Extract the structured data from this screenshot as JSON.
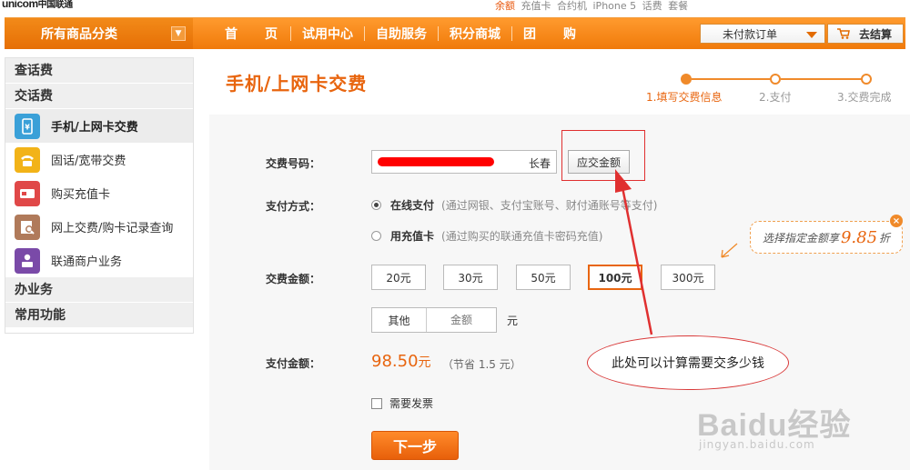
{
  "brand": {
    "logo_en": "unicom",
    "logo_cn": "中国联通"
  },
  "hot_links": [
    "余额",
    "充值卡",
    "合约机",
    "iPhone 5",
    "话费",
    "套餐"
  ],
  "nav": {
    "category_label": "所有商品分类",
    "items": [
      "首　页",
      "试用中心",
      "自助服务",
      "积分商城",
      "团　购"
    ],
    "unpaid_label": "未付款订单",
    "checkout_label": "去结算"
  },
  "sidebar": {
    "sections": [
      "查话费",
      "交话费",
      "办业务",
      "常用功能"
    ],
    "items": [
      {
        "label": "手机/上网卡交费",
        "icon": "phone-pay-icon",
        "color": "#3aa0d8"
      },
      {
        "label": "固话/宽带交费",
        "icon": "telephone-icon",
        "color": "#f2b318"
      },
      {
        "label": "购买充值卡",
        "icon": "card-icon",
        "color": "#e04848"
      },
      {
        "label": "网上交费/购卡记录查询",
        "icon": "record-search-icon",
        "color": "#b07a5a"
      },
      {
        "label": "联通商户业务",
        "icon": "merchant-icon",
        "color": "#7a4aa8"
      }
    ]
  },
  "main": {
    "title": "手机/上网卡交费",
    "steps": [
      "1.填写交费信息",
      "2.支付",
      "3.交费完成"
    ],
    "form": {
      "number_label": "交费号码：",
      "city": "长春",
      "due_button": "应交金额",
      "pay_method_label": "支付方式：",
      "pay_online_title": "在线支付",
      "pay_online_desc": "(通过网银、支付宝账号、财付通账号等支付)",
      "pay_card_title": "用充值卡",
      "pay_card_desc": "(通过购买的联通充值卡密码充值)",
      "amount_label": "交费金额：",
      "amounts": [
        "20元",
        "30元",
        "50元",
        "100元",
        "300元"
      ],
      "selected_amount": "100元",
      "other_label": "其他",
      "other_placeholder": "金额",
      "other_unit": "元",
      "pay_total_label": "支付金额：",
      "pay_total_value": "98.50",
      "pay_total_unit": "元",
      "save_note": "（节省 1.5 元）",
      "invoice_label": "需要发票",
      "next_button": "下一步"
    },
    "promo": {
      "prefix": "选择指定金额享",
      "discount": "9.85",
      "suffix": "折"
    },
    "callout": "此处可以计算需要交多少钱"
  },
  "watermark": {
    "main": "Baidu经验",
    "sub": "jingyan.baidu.com"
  },
  "colors": {
    "accent": "#f08a2a",
    "title": "#e8650f",
    "annotation": "#e03030"
  }
}
